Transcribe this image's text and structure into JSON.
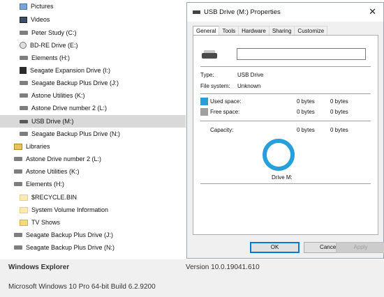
{
  "tree": {
    "items": [
      {
        "label": "Pictures",
        "icon": "pictures-icon"
      },
      {
        "label": "Videos",
        "icon": "videos-icon"
      },
      {
        "label": "Peter Study (C:)",
        "icon": "drive-icon"
      },
      {
        "label": "BD-RE Drive (E:)",
        "icon": "optical-drive-icon"
      },
      {
        "label": "Elements (H:)",
        "icon": "drive-icon"
      },
      {
        "label": "Seagate Expansion Drive (I:)",
        "icon": "drive-dark-icon"
      },
      {
        "label": "Seagate Backup Plus Drive (J:)",
        "icon": "drive-icon"
      },
      {
        "label": "Astone Utilities (K:)",
        "icon": "drive-icon"
      },
      {
        "label": "Astone Drive number 2 (L:)",
        "icon": "drive-icon"
      },
      {
        "label": "USB Drive (M:)",
        "icon": "usb-drive-icon"
      },
      {
        "label": "Seagate Backup Plus Drive (N:)",
        "icon": "drive-icon"
      },
      {
        "label": "Libraries",
        "icon": "library-icon"
      },
      {
        "label": "Astone Drive number 2 (L:)",
        "icon": "drive-icon"
      },
      {
        "label": "Astone Utilities (K:)",
        "icon": "drive-icon"
      },
      {
        "label": "Elements (H:)",
        "icon": "drive-icon"
      },
      {
        "label": "$RECYCLE.BIN",
        "icon": "folder-icon"
      },
      {
        "label": "System Volume Information",
        "icon": "folder-icon"
      },
      {
        "label": "TV Shows",
        "icon": "folder-icon"
      },
      {
        "label": "Seagate Backup Plus Drive (J:)",
        "icon": "drive-icon"
      },
      {
        "label": "Seagate Backup Plus Drive (N:)",
        "icon": "drive-icon"
      }
    ],
    "selected_index": 9
  },
  "dialog": {
    "title": "USB Drive (M:) Properties",
    "close_label": "✕",
    "tabs": [
      "General",
      "Tools",
      "Hardware",
      "Sharing",
      "Customize"
    ],
    "active_tab": "General",
    "name_value": "",
    "type_label": "Type:",
    "type_value": "USB Drive",
    "fs_label": "File system:",
    "fs_value": "Unknown",
    "used_label": "Used space:",
    "used_bytes": "0 bytes",
    "used_size": "0 bytes",
    "free_label": "Free space:",
    "free_bytes": "0 bytes",
    "free_size": "0 bytes",
    "capacity_label": "Capacity:",
    "capacity_bytes": "0 bytes",
    "capacity_size": "0 bytes",
    "drive_caption": "Drive M:",
    "ok_label": "OK",
    "cancel_label": "Cancel",
    "apply_label": "Apply",
    "colors": {
      "used": "#26a0da",
      "free": "#a0a0a0"
    }
  },
  "footer": {
    "app_name": "Windows Explorer",
    "version": "Version 10.0.19041.610",
    "os": "Microsoft Windows 10 Pro 64-bit Build 6.2.9200"
  }
}
